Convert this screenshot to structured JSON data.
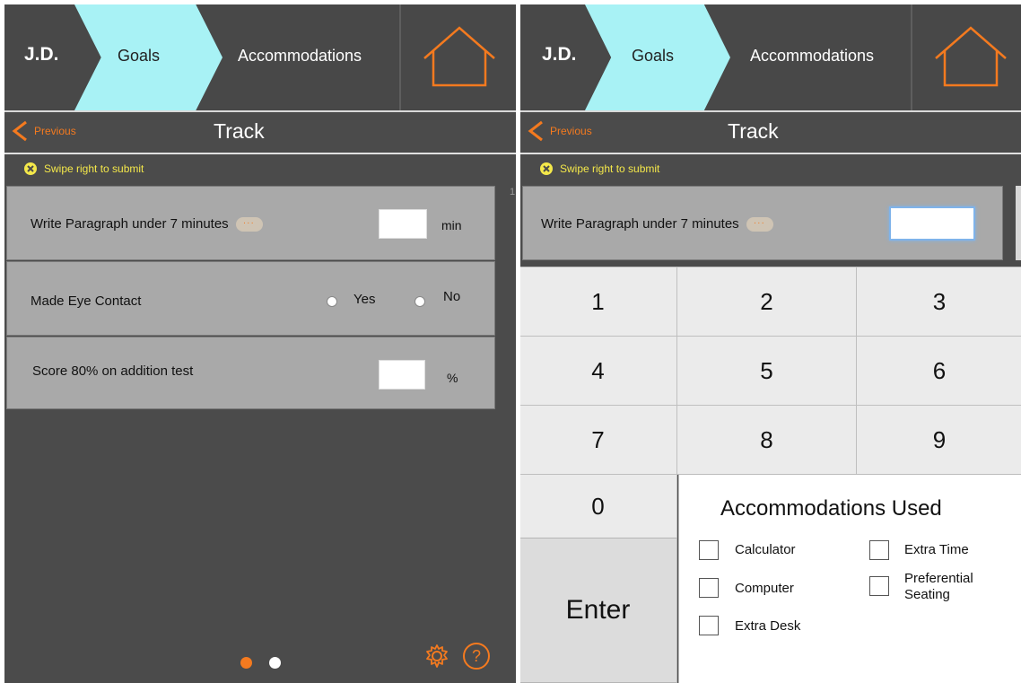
{
  "colors": {
    "panel_bg": "#4b4b4b",
    "goals_tab": "#a8f2f5",
    "accent_orange": "#f47a1f",
    "notice_yellow": "#f4e84a",
    "row_bg": "#a9a9a9",
    "keypad_bg": "#ebebeb"
  },
  "left": {
    "nav": {
      "initials": "J.D.",
      "goals": "Goals",
      "accommodations": "Accommodations",
      "home_icon": "home-icon"
    },
    "header": {
      "previous": "Previous",
      "title": "Track",
      "swipe_notice": "Swipe right to submit"
    },
    "goals": [
      {
        "label": "Write Paragraph under 7 minutes",
        "more": "···",
        "input_value": "",
        "unit": "min"
      },
      {
        "label": "Made Eye Contact",
        "option_yes": "Yes",
        "option_no": "No"
      },
      {
        "label": "Score 80% on addition test",
        "input_value": "",
        "unit": "%"
      }
    ],
    "pager": {
      "pages": 2,
      "current": 1
    },
    "footer": {
      "settings_icon": "gear-icon",
      "help_icon": "help-icon",
      "help_glyph": "?"
    }
  },
  "right": {
    "nav": {
      "initials": "J.D.",
      "goals": "Goals",
      "accommodations": "Accommodations",
      "home_icon": "home-icon"
    },
    "header": {
      "previous": "Previous",
      "title": "Track",
      "swipe_notice": "Swipe right to submit"
    },
    "goal": {
      "label": "Write Paragraph under 7 minutes",
      "more": "···",
      "input_value": ""
    },
    "edge_mark": "1",
    "keypad": {
      "keys": [
        "1",
        "2",
        "3",
        "4",
        "5",
        "6",
        "7",
        "8",
        "9",
        "0"
      ],
      "enter": "Enter"
    },
    "accommodations": {
      "title": "Accommodations Used",
      "items": [
        "Calculator",
        "Extra Time",
        "Computer",
        "Preferential Seating",
        "Extra Desk"
      ]
    }
  }
}
